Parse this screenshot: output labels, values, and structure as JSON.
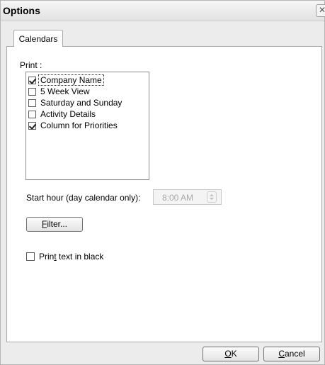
{
  "window": {
    "title": "Options",
    "close_glyph": "✕"
  },
  "tabs": [
    {
      "label": "Calendars",
      "selected": true
    }
  ],
  "print_section": {
    "label": "Print :",
    "items": [
      {
        "label": "Company Name",
        "checked": true,
        "focused": true
      },
      {
        "label": "5 Week View",
        "checked": false
      },
      {
        "label": "Saturday and Sunday",
        "checked": false
      },
      {
        "label": "Activity Details",
        "checked": false
      },
      {
        "label": "Column for Priorities",
        "checked": true
      }
    ]
  },
  "start_hour": {
    "label": "Start hour (day calendar only):",
    "value": "8:00 AM",
    "enabled": false
  },
  "filter_button": {
    "label_prefix": "",
    "mnemonic": "F",
    "label_rest": "ilter..."
  },
  "print_black": {
    "label_pre": "Prin",
    "mnemonic": "t",
    "label_post": " text in black",
    "checked": false
  },
  "footer": {
    "ok": {
      "mnemonic": "O",
      "rest": "K"
    },
    "cancel": {
      "mnemonic": "C",
      "rest": "ancel"
    }
  },
  "icons": {
    "close": "close-icon",
    "spin": "spin-arrows-icon",
    "check": "checkmark-icon"
  }
}
